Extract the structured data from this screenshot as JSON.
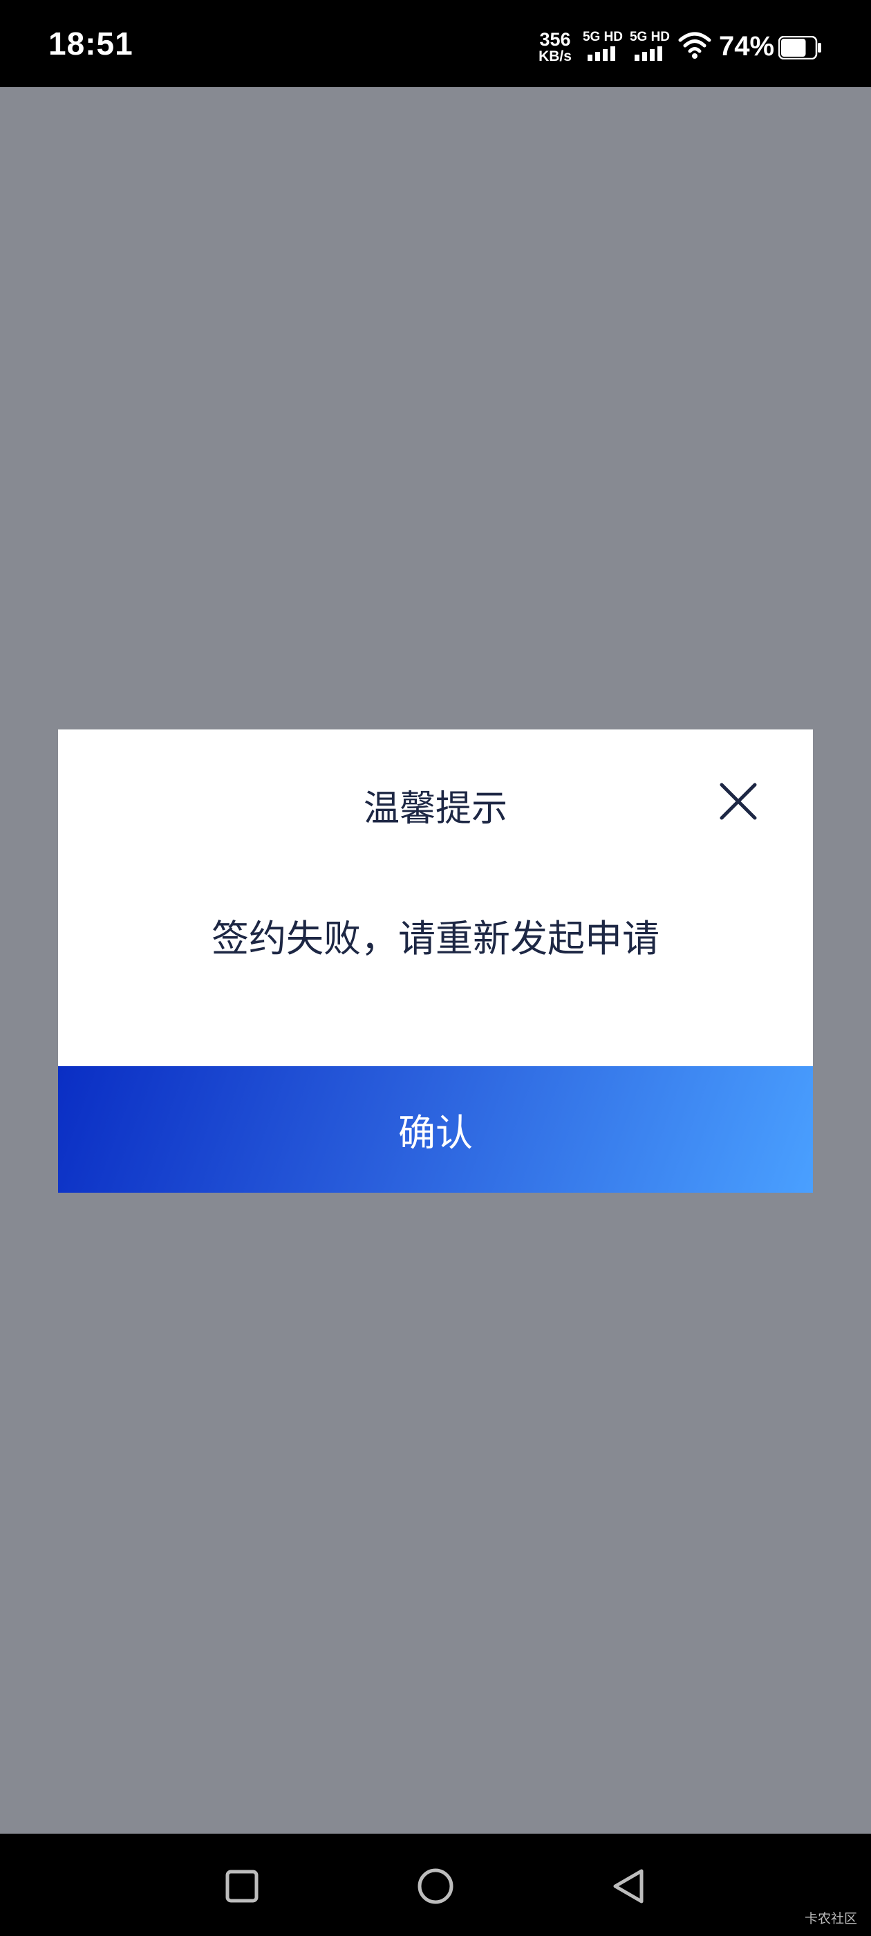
{
  "status_bar": {
    "time": "18:51",
    "net_speed_value": "356",
    "net_speed_unit": "KB/s",
    "sim1_label": "5G HD",
    "sim2_label": "5G HD",
    "battery_percent": "74%",
    "battery_level": 0.74,
    "icons": [
      "signal-icon",
      "signal-icon",
      "wifi-icon",
      "battery-icon"
    ]
  },
  "dialog": {
    "title": "温馨提示",
    "message": "签约失败，请重新发起申请",
    "confirm_label": "确认",
    "close_icon": "close-icon",
    "accent_gradient": [
      "#0a2ec4",
      "#4aa0ff"
    ]
  },
  "nav_bar": {
    "buttons": [
      "recents-square-icon",
      "home-circle-icon",
      "back-triangle-icon"
    ]
  },
  "watermark": "卡农社区"
}
